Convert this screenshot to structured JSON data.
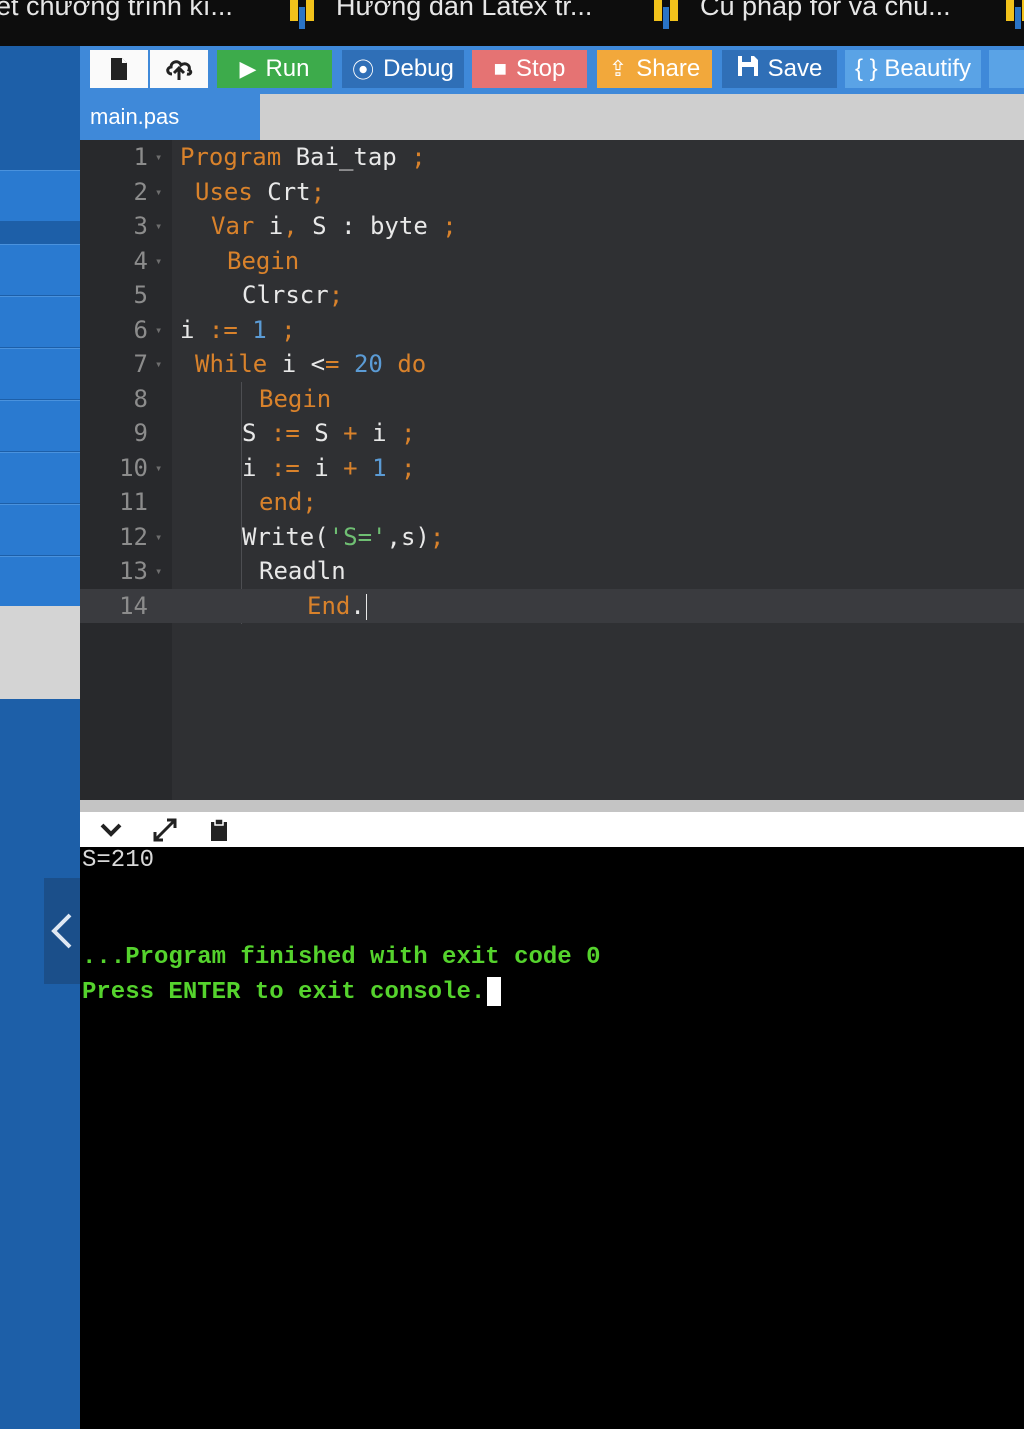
{
  "browser_tabs": [
    {
      "label": "ết chương trình kí..."
    },
    {
      "label": "Hướng dẫn Latex tr..."
    },
    {
      "label": "Cú pháp for và chú..."
    }
  ],
  "toolbar": {
    "run": "Run",
    "debug": "Debug",
    "stop": "Stop",
    "share": "Share",
    "save": "Save",
    "beautify": "{ } Beautify",
    "colors": {
      "run": "#3dab4b",
      "debug": "#2f6fb7",
      "stop": "#e57373",
      "share": "#f2a83b",
      "save": "#2f6fb7",
      "beautify": "#5aa3e6"
    }
  },
  "file_tab": {
    "name": "main.pas"
  },
  "editor": {
    "lines": [
      {
        "n": "1",
        "fold": true
      },
      {
        "n": "2",
        "fold": true
      },
      {
        "n": "3",
        "fold": true
      },
      {
        "n": "4",
        "fold": true
      },
      {
        "n": "5",
        "fold": false
      },
      {
        "n": "6",
        "fold": true
      },
      {
        "n": "7",
        "fold": true
      },
      {
        "n": "8",
        "fold": false
      },
      {
        "n": "9",
        "fold": false
      },
      {
        "n": "10",
        "fold": true
      },
      {
        "n": "11",
        "fold": false
      },
      {
        "n": "12",
        "fold": true
      },
      {
        "n": "13",
        "fold": true
      },
      {
        "n": "14",
        "fold": false
      }
    ],
    "code": {
      "l1": [
        "Program",
        " Bai_tap ",
        ";"
      ],
      "l2": [
        "Uses",
        " Crt",
        ";"
      ],
      "l3": [
        "Var",
        " i",
        ",",
        " S : byte ",
        ";"
      ],
      "l4": [
        "Begin"
      ],
      "l5": [
        "Clrscr",
        ";"
      ],
      "l6": [
        "i ",
        ":=",
        " ",
        "1",
        " ",
        ";"
      ],
      "l7": [
        "While",
        " i <",
        "=",
        " ",
        "20",
        " ",
        "do"
      ],
      "l8": [
        "Begin"
      ],
      "l9": [
        "S ",
        ":=",
        " S ",
        "+",
        " i ",
        ";"
      ],
      "l10": [
        "i ",
        ":=",
        " i ",
        "+",
        " ",
        "1",
        " ",
        ";"
      ],
      "l11": [
        "end",
        ";"
      ],
      "l12": [
        "Write(",
        "'S='",
        ",s)",
        ";"
      ],
      "l13": [
        "Readln"
      ],
      "l14": [
        "End",
        "."
      ]
    },
    "active_line": 14
  },
  "console": {
    "output_line": "S=210",
    "finish_line": "...Program finished with exit code 0",
    "prompt_line": "Press ENTER to exit console."
  }
}
